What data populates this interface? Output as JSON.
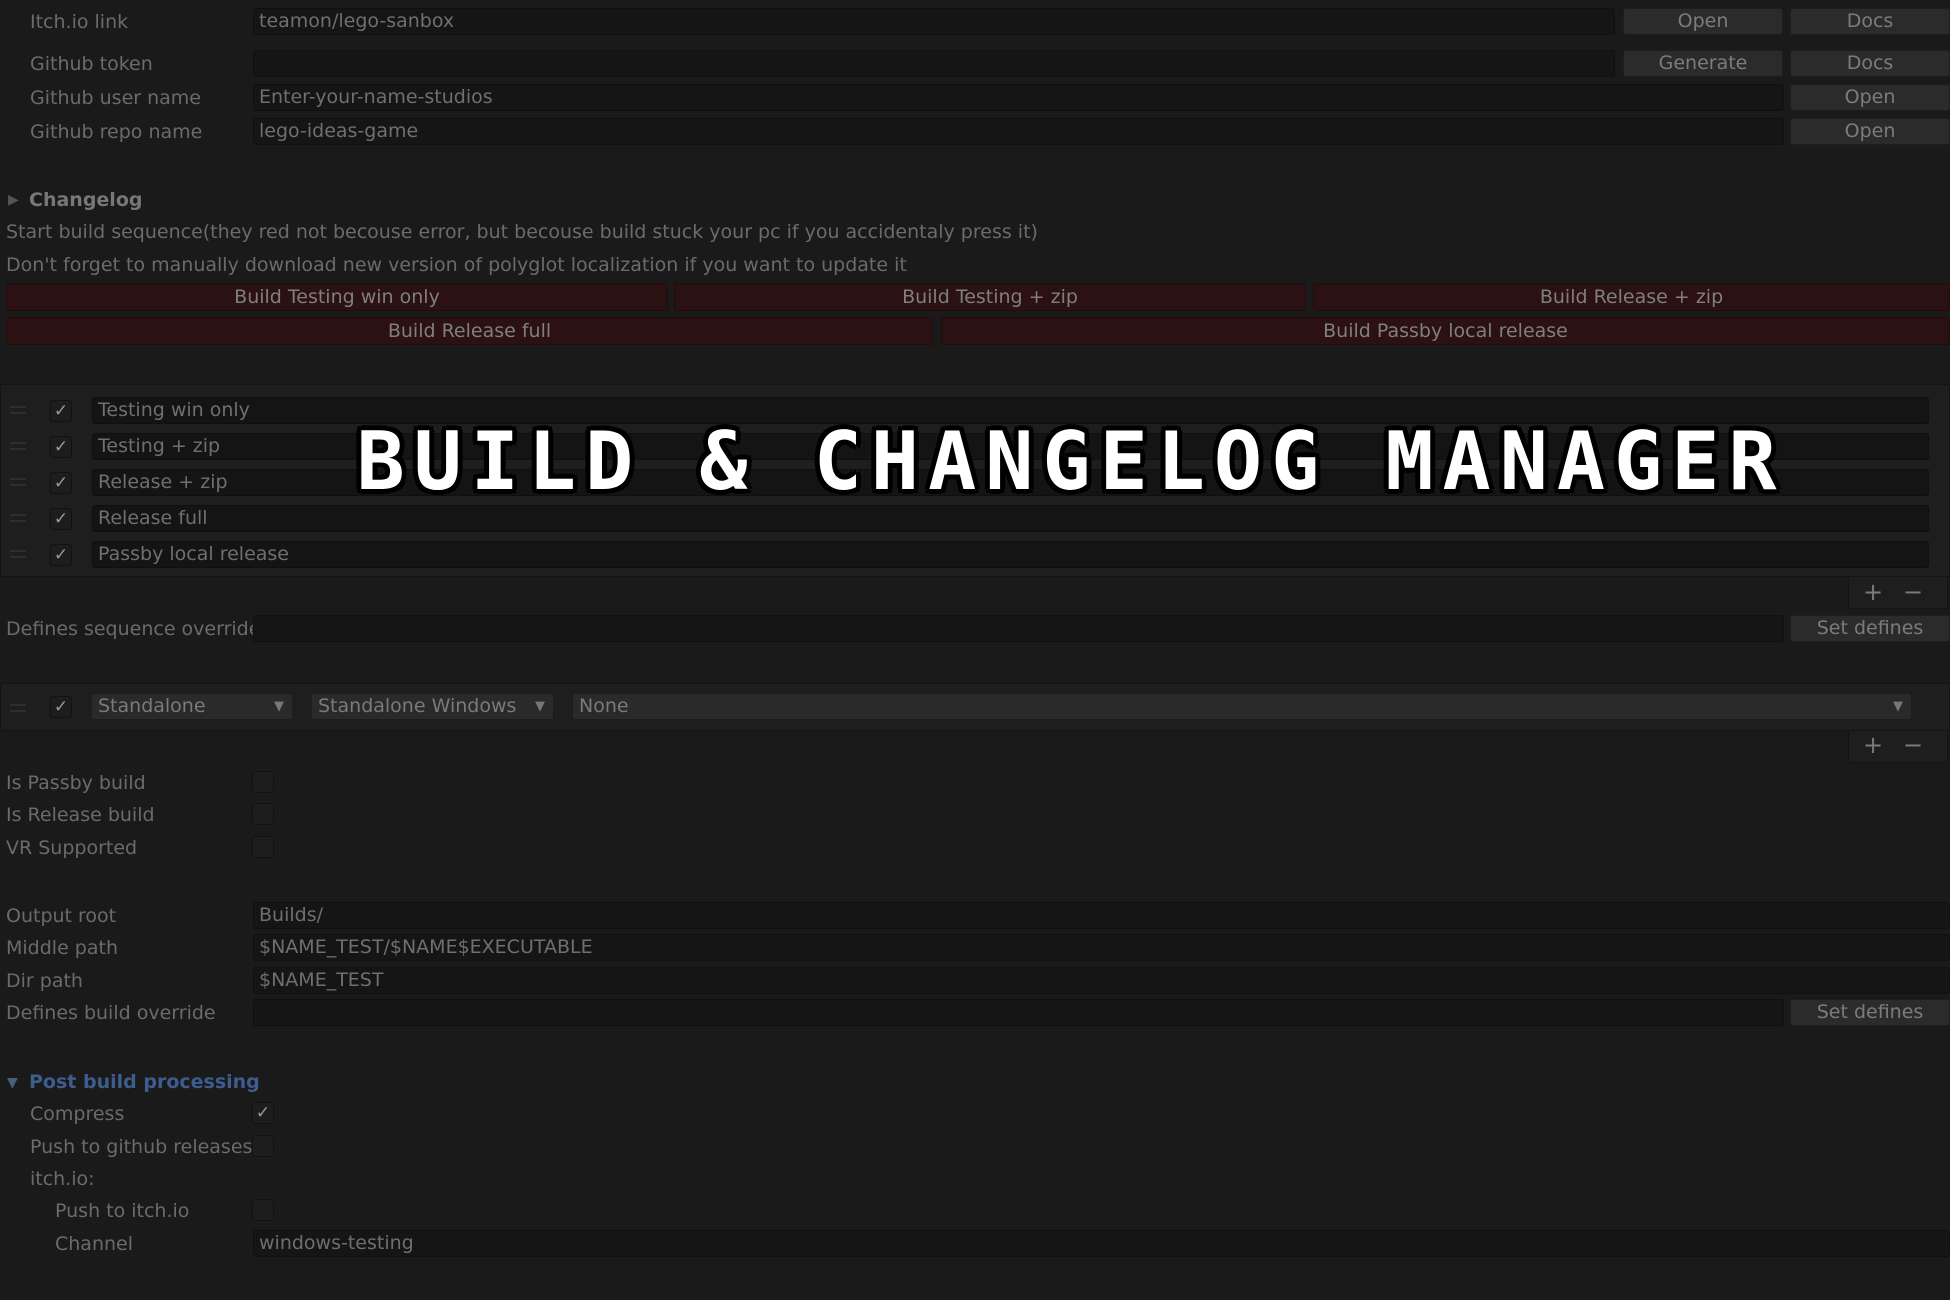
{
  "top_fields": {
    "itch_label": "Itch.io link",
    "itch_value": "teamon/lego-sanbox",
    "itch_open": "Open",
    "itch_docs": "Docs",
    "token_label": "Github token",
    "token_value": "",
    "token_generate": "Generate",
    "token_docs": "Docs",
    "user_label": "Github user name",
    "user_value": "Enter-your-name-studios",
    "user_open": "Open",
    "repo_label": "Github repo name",
    "repo_value": "lego-ideas-game",
    "repo_open": "Open"
  },
  "changelog": {
    "label": "Changelog",
    "line1": "Start build sequence(they red not becouse error, but becouse build stuck your pc if you accidentaly press it)",
    "line2": "Don't forget to manually download new version of polyglot localization if you want to update it"
  },
  "build_buttons": {
    "testing_win": "Build Testing win only",
    "testing_zip": "Build Testing + zip",
    "release_zip": "Build Release + zip",
    "release_full": "Build Release full",
    "passby_local": "Build Passby local release"
  },
  "sequence_list": {
    "items": [
      {
        "label": "Testing win only",
        "checked": true
      },
      {
        "label": "Testing + zip",
        "checked": true
      },
      {
        "label": "Release + zip",
        "checked": true
      },
      {
        "label": "Release full",
        "checked": true
      },
      {
        "label": "Passby local release",
        "checked": true
      }
    ],
    "add": "+",
    "remove": "−",
    "check_mark": "✓"
  },
  "defines_sequence": {
    "label": "Defines sequence override",
    "value": "",
    "button": "Set defines"
  },
  "target_list": {
    "platform": "Standalone",
    "target": "Standalone Windows",
    "option": "None",
    "add": "+",
    "remove": "−"
  },
  "flags": {
    "passby_label": "Is Passby build",
    "release_label": "Is Release build",
    "vr_label": "VR Supported"
  },
  "paths": {
    "output_root_label": "Output root",
    "output_root_value": "Builds/",
    "middle_path_label": "Middle path",
    "middle_path_value": "$NAME_TEST/$NAME$EXECUTABLE",
    "dir_path_label": "Dir path",
    "dir_path_value": "$NAME_TEST",
    "defines_build_label": "Defines build override",
    "defines_build_value": "",
    "defines_build_button": "Set defines"
  },
  "post_build": {
    "label": "Post build processing",
    "compress_label": "Compress",
    "push_github_label": "Push to github releases",
    "itch_label": "itch.io:",
    "push_itch_label": "Push to itch.io",
    "channel_label": "Channel",
    "channel_value": "windows-testing"
  },
  "overlay": {
    "title": "BUILD & CHANGELOG MANAGER"
  },
  "colors": {
    "background": "#1a1a1a",
    "build_button": "#2b1111",
    "foldout_blue": "#3d5d8f"
  }
}
